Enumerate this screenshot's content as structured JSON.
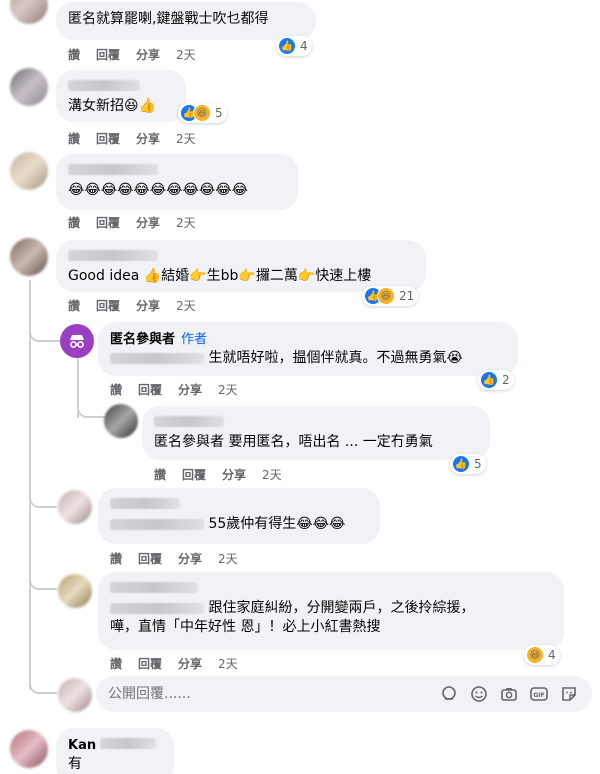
{
  "labels": {
    "like": "讚",
    "reply": "回覆",
    "share": "分享",
    "time": "2天"
  },
  "comments": [
    {
      "text": "匿名就算罷喇,鍵盤戰士吹乜都得",
      "reactions": "4"
    },
    {
      "text": "溝女新招",
      "reactions": "5"
    },
    {
      "text": "",
      "reactions": ""
    },
    {
      "text_a": "Good idea",
      "text_b": "結婚",
      "text_c": "生bb",
      "text_d": "攞二萬",
      "text_e": "快速上樓",
      "reactions": "21"
    },
    {
      "author": "匿名參與者",
      "author_tag": "作者",
      "text": "生就唔好啦，揾個伴就真。不過無勇氣",
      "reactions": "2"
    },
    {
      "text": "匿名參與者 要用匿名，唔出名 ... 一定冇勇氣",
      "reactions": "5"
    },
    {
      "text": "55歲仲有得生",
      "reactions": ""
    },
    {
      "text_line1": "跟住家庭糾紛，分開變兩戶，之後拎綜援，",
      "text_line2": "嘩，直情「中年好性 恩」！必上小紅書熱搜",
      "reactions": "4"
    },
    {
      "name_partial": "Kan",
      "text": "有"
    }
  ],
  "reply_box": {
    "placeholder": "公開回覆......"
  }
}
